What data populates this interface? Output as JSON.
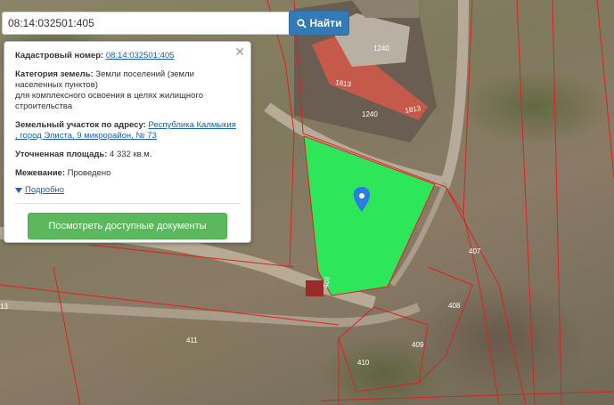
{
  "search": {
    "value": "08:14:032501:405",
    "button_label": "Найти"
  },
  "popup": {
    "cadastral_label": "Кадастровый номер:",
    "cadastral_value": "08:14:032501:405",
    "category_label": "Категория земель:",
    "category_value_1": "Земли поселений (земли",
    "category_value_2": "населенных пунктов)",
    "category_value_3": "для комплексного освоения в целях жилищного",
    "category_value_4": "строительства",
    "address_label": "Земельный участок по адресу:",
    "address_value_1": "Республика Калмыкия",
    "address_value_2": ", город Элиста, 9 микрорайон, № 73",
    "area_label": "Уточненная площадь:",
    "area_value": "4 332 кв.м.",
    "survey_label": "Межевание:",
    "survey_value": "Проведено",
    "more_link": "Подробно",
    "docs_button": "Посмотреть доступные документы"
  },
  "map": {
    "parcel_labels": [
      "1240",
      "1813",
      "1240",
      "1813",
      "406",
      "407",
      "408",
      "409",
      "410",
      "411",
      "13"
    ],
    "selected_color": "#2ee65a",
    "boundary_color": "#e02020"
  }
}
